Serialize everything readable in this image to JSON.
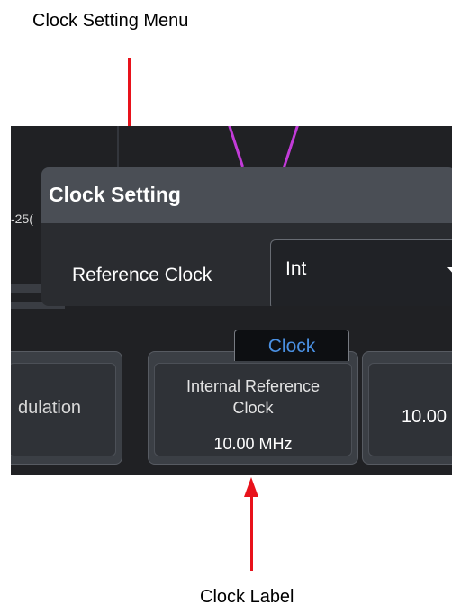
{
  "annotations": {
    "top_label": "Clock Setting Menu",
    "bottom_label": "Clock Label"
  },
  "screen": {
    "axis_partial_label": "-25("
  },
  "dialog": {
    "title": "Clock Setting",
    "reference_clock_label": "Reference Clock",
    "reference_clock_value": "Int"
  },
  "softkeys": {
    "modulation_partial_label": "dulation",
    "clock": {
      "tab_label": "Clock",
      "title_line1": "Internal Reference",
      "title_line2": "Clock",
      "value": "10.00 MHz"
    },
    "right_partial_value": "10.00"
  },
  "colors": {
    "annotation_arrow": "#e8121b",
    "clock_tab_text": "#4a90e2",
    "trace": "#c23bd8",
    "background": "#202124"
  }
}
